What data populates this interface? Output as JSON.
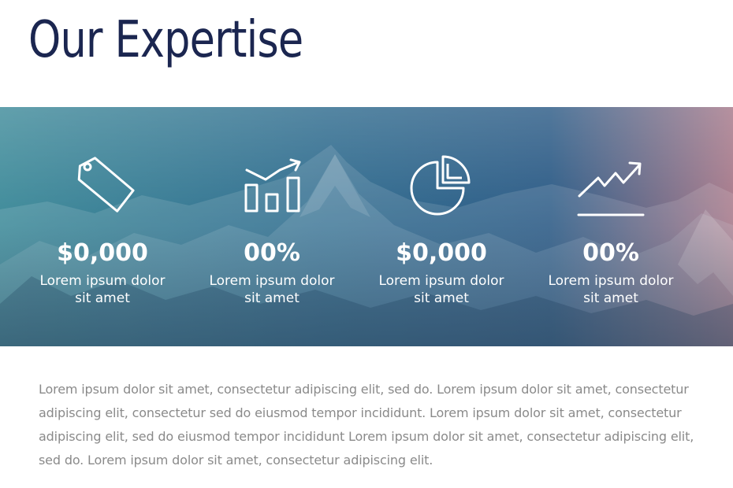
{
  "heading": {
    "title": "Our Expertise"
  },
  "banner": {
    "colors": {
      "left": "#3f8b9a",
      "middle": "#2c5b86",
      "right": "#a6798a"
    },
    "stats": [
      {
        "icon": "price-tag-icon",
        "value": "$0,000",
        "label_line1": "Lorem ipsum dolor",
        "label_line2": "sit amet"
      },
      {
        "icon": "bar-chart-growth-icon",
        "value": "00%",
        "label_line1": "Lorem ipsum dolor",
        "label_line2": "sit amet"
      },
      {
        "icon": "pie-chart-icon",
        "value": "$0,000",
        "label_line1": "Lorem ipsum dolor",
        "label_line2": "sit amet"
      },
      {
        "icon": "trend-line-icon",
        "value": "00%",
        "label_line1": "Lorem ipsum dolor",
        "label_line2": "sit amet"
      }
    ]
  },
  "body": {
    "paragraph": "Lorem ipsum dolor sit amet, consectetur adipiscing elit, sed do. Lorem ipsum dolor sit amet, consectetur adipiscing elit, consectetur sed do eiusmod tempor incididunt. Lorem ipsum dolor sit amet, consectetur adipiscing elit, sed do eiusmod tempor incididunt Lorem ipsum dolor sit amet, consectetur adipiscing elit, sed do. Lorem ipsum dolor sit amet, consectetur adipiscing elit."
  }
}
